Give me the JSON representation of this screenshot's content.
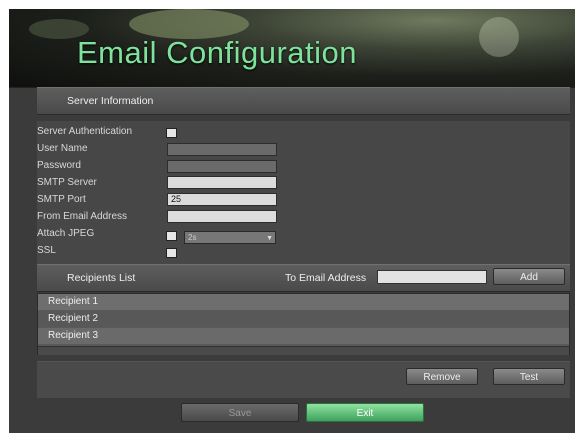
{
  "title": "Email Configuration",
  "server_section": {
    "label": "Server Information"
  },
  "fields": {
    "server_authentication": {
      "label": "Server Authentication"
    },
    "user_name": {
      "label": "User Name",
      "value": ""
    },
    "password": {
      "label": "Password",
      "value": ""
    },
    "smtp_server": {
      "label": "SMTP Server",
      "value": ""
    },
    "smtp_port": {
      "label": "SMTP Port",
      "value": "25"
    },
    "from_email": {
      "label": "From Email Address",
      "value": ""
    },
    "attach_jpeg": {
      "label": "Attach JPEG",
      "interval": "2s"
    },
    "ssl": {
      "label": "SSL"
    }
  },
  "recipients": {
    "label": "Recipients List",
    "to_label": "To Email Address",
    "to_value": "",
    "add_label": "Add",
    "items": [
      "Recipient 1",
      "Recipient 2",
      "Recipient 3"
    ],
    "remove_label": "Remove",
    "test_label": "Test"
  },
  "footer": {
    "save_label": "Save",
    "exit_label": "Exit"
  }
}
